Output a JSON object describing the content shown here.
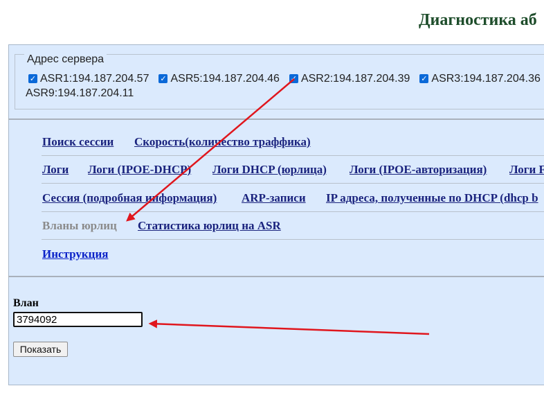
{
  "page_title": "Диагностика аб",
  "server_section": {
    "legend": "Адрес сервера",
    "servers": [
      {
        "label": "ASR1:194.187.204.57",
        "checked": true
      },
      {
        "label": "ASR5:194.187.204.46",
        "checked": true
      },
      {
        "label": "ASR2:194.187.204.39",
        "checked": true
      },
      {
        "label": "ASR3:194.187.204.36",
        "checked": true
      },
      {
        "label": "ASR9:194.187.204.11",
        "checked": false
      }
    ]
  },
  "nav": {
    "row1": [
      "Поиск сессии",
      "Скорость(количество траффика)"
    ],
    "row2": [
      "Логи",
      "Логи (IPOE-DHCP)",
      "Логи DHCP (юрлица)",
      "Логи (IPOE-авторизация)",
      "Логи F"
    ],
    "row3": [
      "Сессия (подробная информация)",
      "ARP-записи",
      "IP адреса, полученные по DHCP (dhcp b"
    ],
    "row4": [
      "Вланы юрлиц",
      "Статистика юрлиц на ASR"
    ],
    "row5": [
      "Инструкция"
    ],
    "current": "Вланы юрлиц"
  },
  "form": {
    "vlan_label": "Влан",
    "vlan_value": "3794092",
    "submit_label": "Показать"
  },
  "annotation_color": "#e0161d"
}
